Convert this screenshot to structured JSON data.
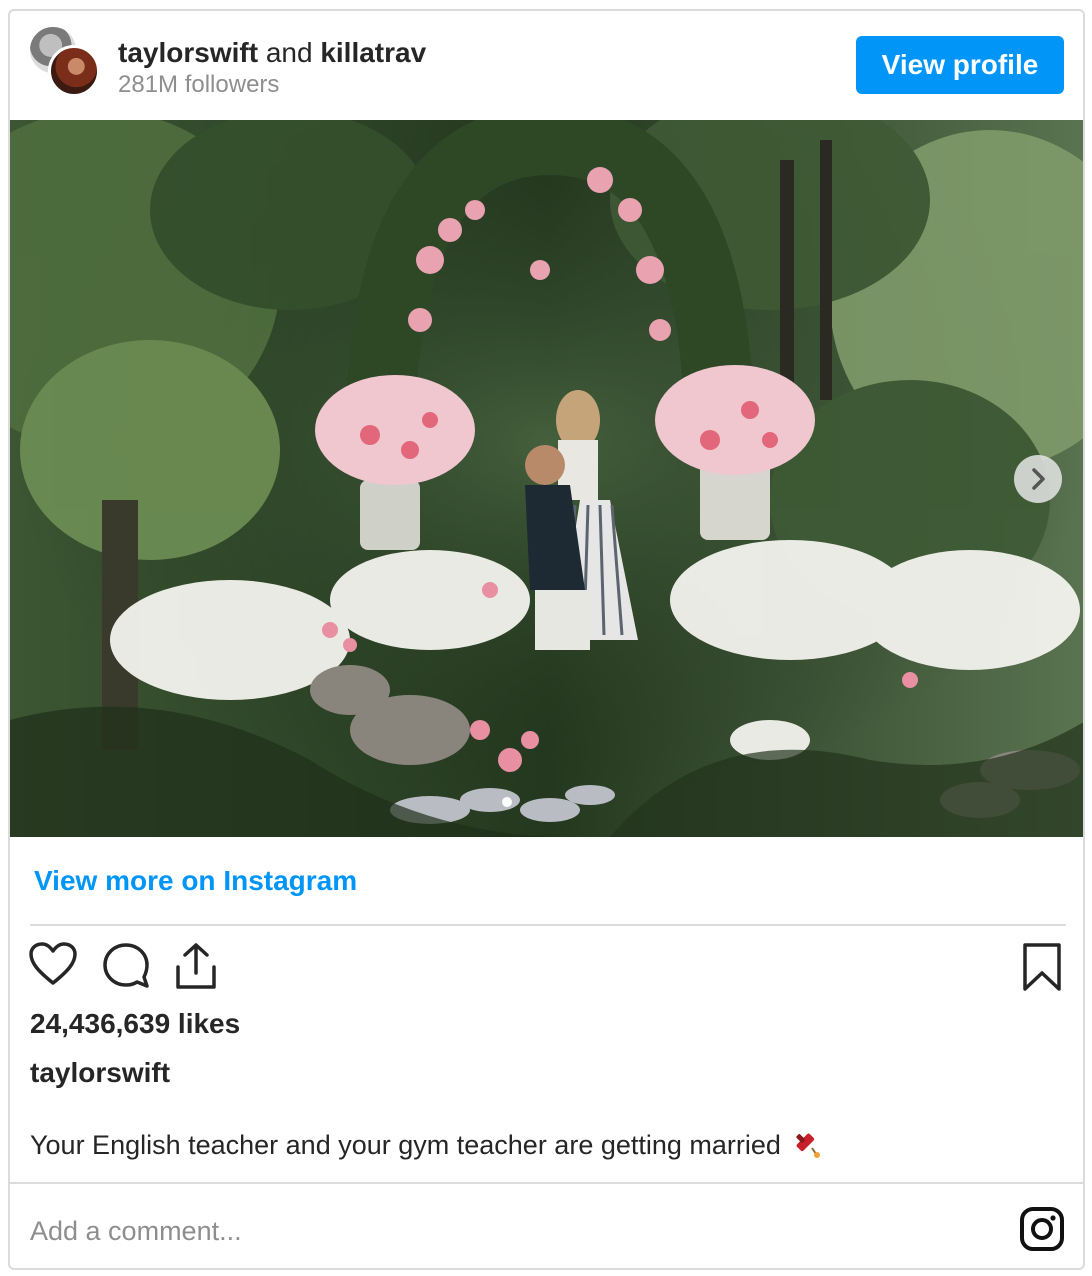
{
  "header": {
    "user_primary": "taylorswift",
    "joiner": "and",
    "user_secondary": "killatrav",
    "followers": "281M followers",
    "view_profile_label": "View profile"
  },
  "photo": {
    "carousel_total": 1,
    "carousel_active": 1
  },
  "view_more_label": "View more on Instagram",
  "likes": "24,436,639 likes",
  "caption": {
    "user": "taylorswift",
    "text": "Your English teacher and your gym teacher are getting married"
  },
  "comment": {
    "placeholder": "Add a comment..."
  },
  "icons": {
    "like": "heart-icon",
    "comment": "comment-bubble-icon",
    "share": "share-icon",
    "save": "bookmark-icon",
    "next": "chevron-right-icon",
    "brand": "instagram-logo-icon",
    "emoji": "firecracker-emoji"
  },
  "colors": {
    "accent": "#0095f6",
    "border": "#dbdbdb",
    "muted": "#8e8e8e",
    "text": "#262626"
  }
}
